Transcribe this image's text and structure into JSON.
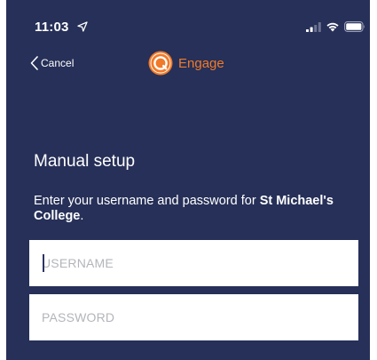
{
  "status_bar": {
    "time": "11:03",
    "icons": [
      "location-arrow-icon",
      "signal-bars-icon",
      "wifi-icon",
      "battery-icon"
    ]
  },
  "nav": {
    "cancel_label": "Cancel",
    "brand_name": "Engage"
  },
  "content": {
    "title": "Manual setup",
    "instructions_prefix": "Enter your username and password for ",
    "instructions_school": "St Michael's College",
    "instructions_suffix": "."
  },
  "form": {
    "username_placeholder": "USERNAME",
    "username_value": "",
    "password_placeholder": "PASSWORD",
    "password_value": ""
  },
  "colors": {
    "background": "#263058",
    "brand_accent": "#f07a2a",
    "field_background": "#ffffff",
    "placeholder_text": "#b3b5bb"
  }
}
